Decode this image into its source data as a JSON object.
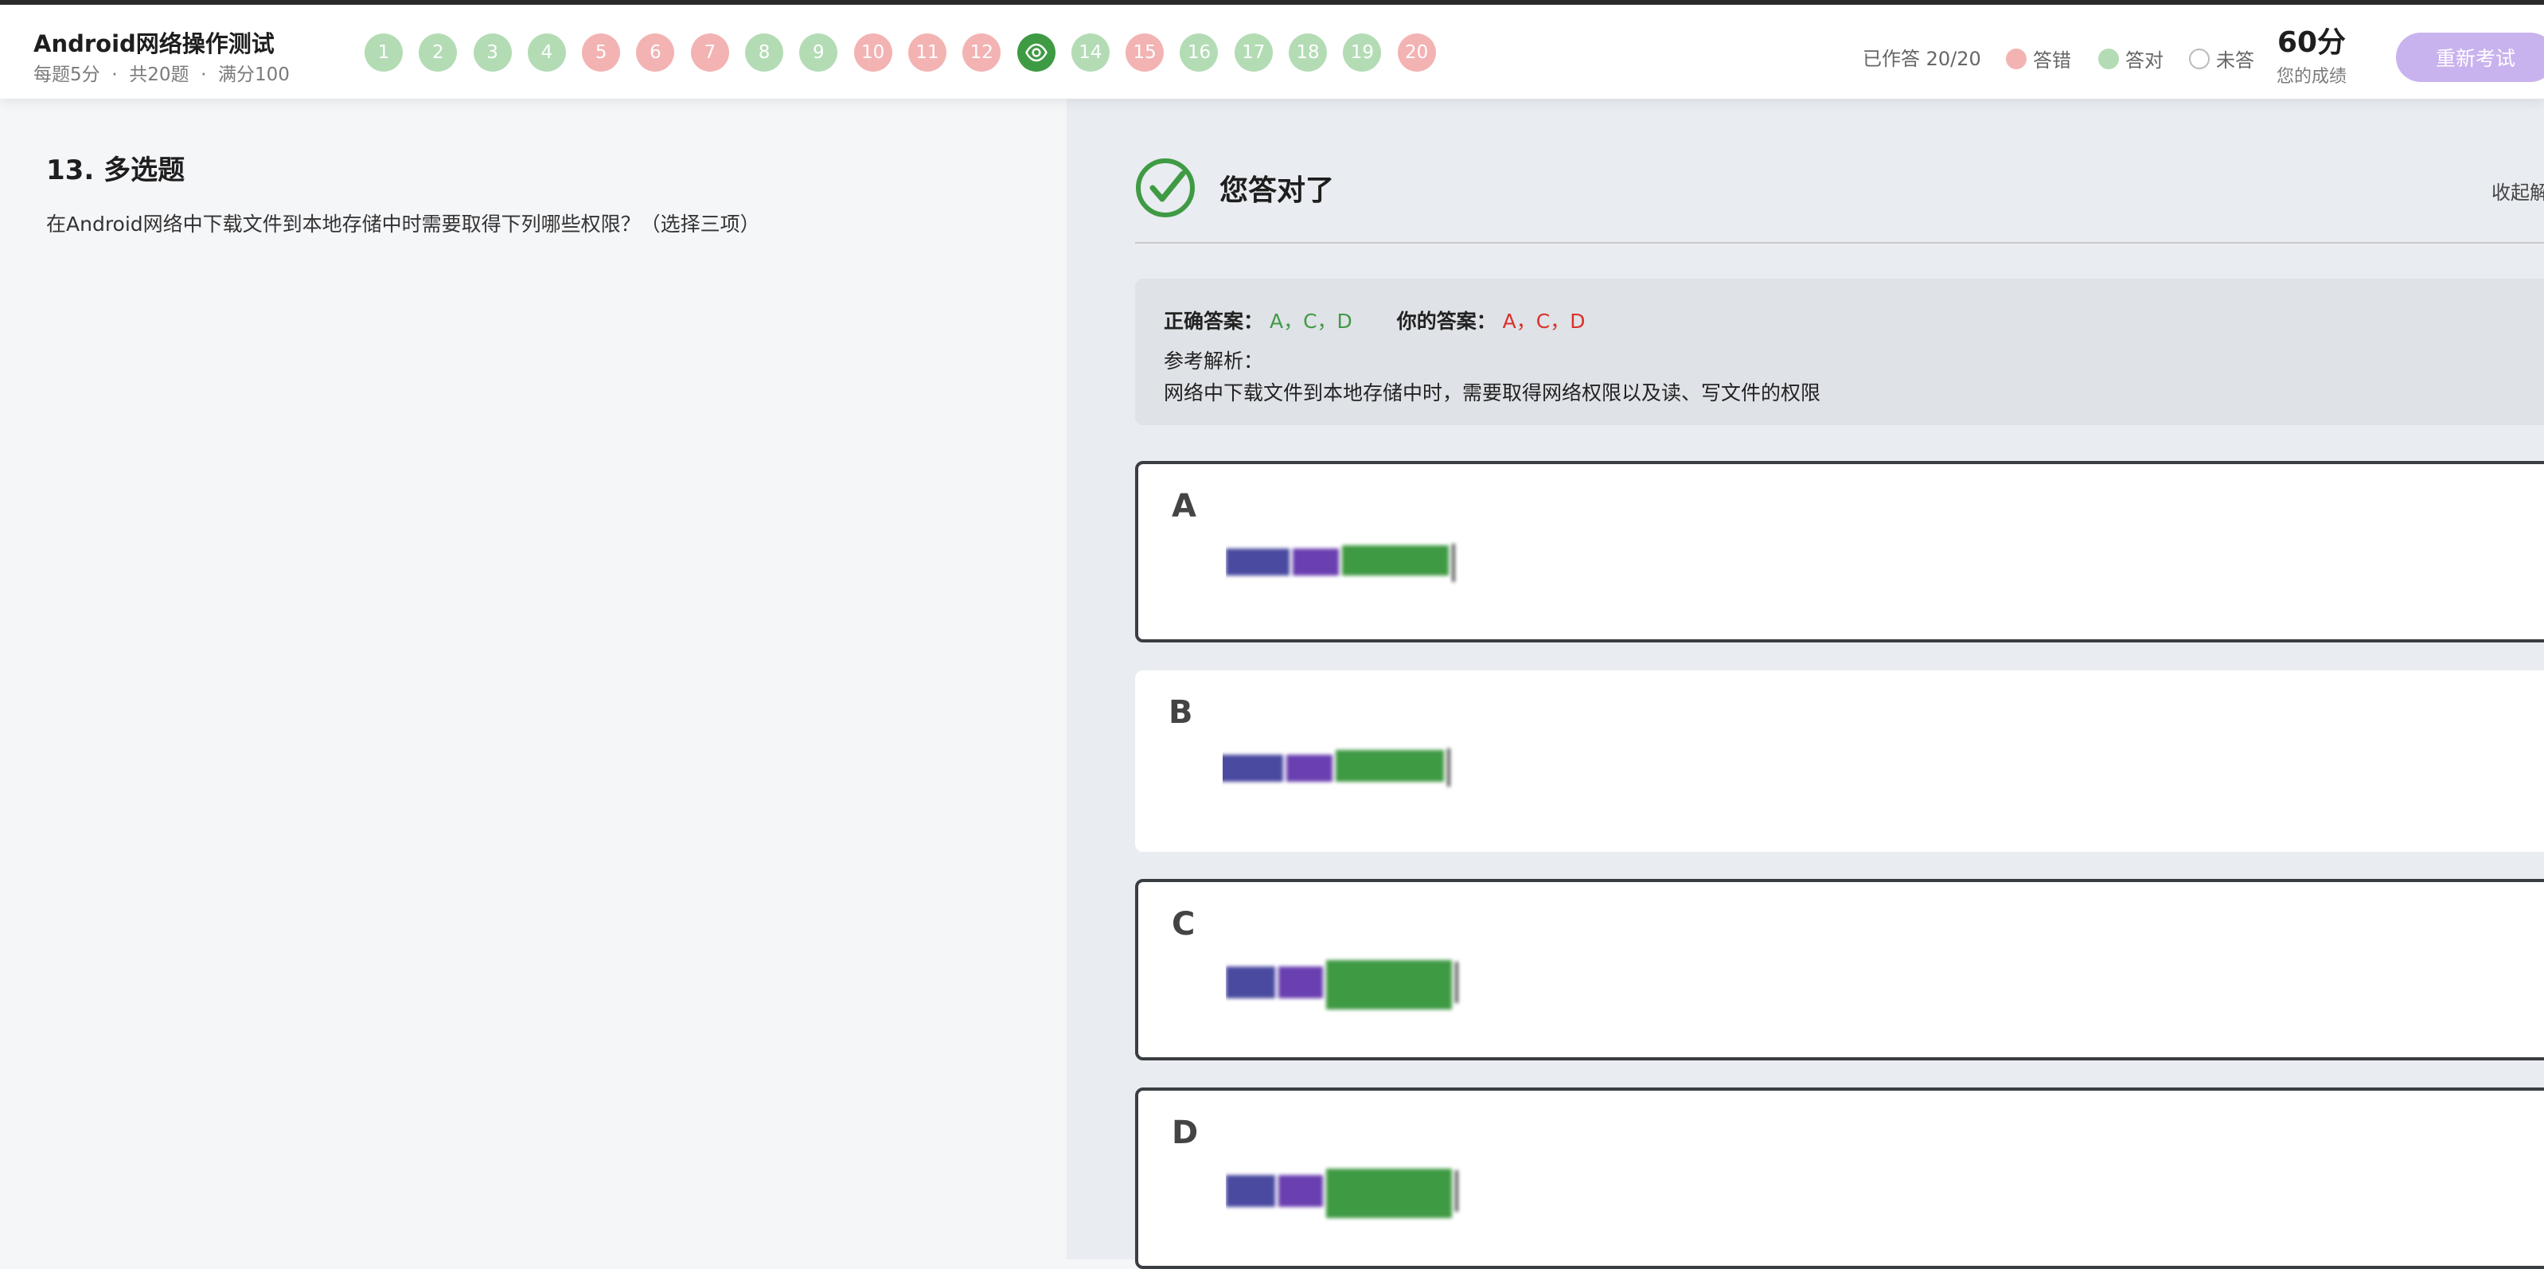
{
  "header": {
    "title": "Android网络操作测试",
    "subtitle": "每题5分  ·  共20题  ·  满分100",
    "questions": [
      {
        "num": "1",
        "state": "ok"
      },
      {
        "num": "2",
        "state": "ok"
      },
      {
        "num": "3",
        "state": "ok"
      },
      {
        "num": "4",
        "state": "ok"
      },
      {
        "num": "5",
        "state": "bad"
      },
      {
        "num": "6",
        "state": "bad"
      },
      {
        "num": "7",
        "state": "bad"
      },
      {
        "num": "8",
        "state": "ok"
      },
      {
        "num": "9",
        "state": "ok"
      },
      {
        "num": "10",
        "state": "bad"
      },
      {
        "num": "11",
        "state": "bad"
      },
      {
        "num": "12",
        "state": "bad"
      },
      {
        "num": "13",
        "state": "current",
        "icon": "eye-icon"
      },
      {
        "num": "14",
        "state": "ok"
      },
      {
        "num": "15",
        "state": "bad"
      },
      {
        "num": "16",
        "state": "ok"
      },
      {
        "num": "17",
        "state": "ok"
      },
      {
        "num": "18",
        "state": "ok"
      },
      {
        "num": "19",
        "state": "ok"
      },
      {
        "num": "20",
        "state": "bad"
      }
    ],
    "answered": "已作答 20/20",
    "legend": {
      "wrong": "答错",
      "right": "答对",
      "unanswered": "未答"
    },
    "score_value": "60分",
    "score_label": "您的成绩",
    "retake_label": "重新考试"
  },
  "question": {
    "title": "13. 多选题",
    "text": "在Android网络中下载文件到本地存储中时需要取得下列哪些权限？（选择三项）"
  },
  "result": {
    "title": "您答对了",
    "collapse_label": "收起解析",
    "correct_label": "正确答案：",
    "correct_value": "A，C，D",
    "yours_label": "你的答案：",
    "yours_value": "A，C，D",
    "explain_label": "参考解析：",
    "explain_text": "网络中下载文件到本地存储中时，需要取得网络权限以及读、写文件的权限"
  },
  "options": [
    {
      "letter": "A",
      "selected": true
    },
    {
      "letter": "B",
      "selected": false
    },
    {
      "letter": "C",
      "selected": true
    },
    {
      "letter": "D",
      "selected": true
    }
  ],
  "colors": {
    "ok": "#b3dcb4",
    "bad": "#f3b3b3",
    "current": "#3f9a44",
    "accent": "#c9b3ee",
    "correct_text": "#3f9a44",
    "user_text": "#d9322b"
  }
}
